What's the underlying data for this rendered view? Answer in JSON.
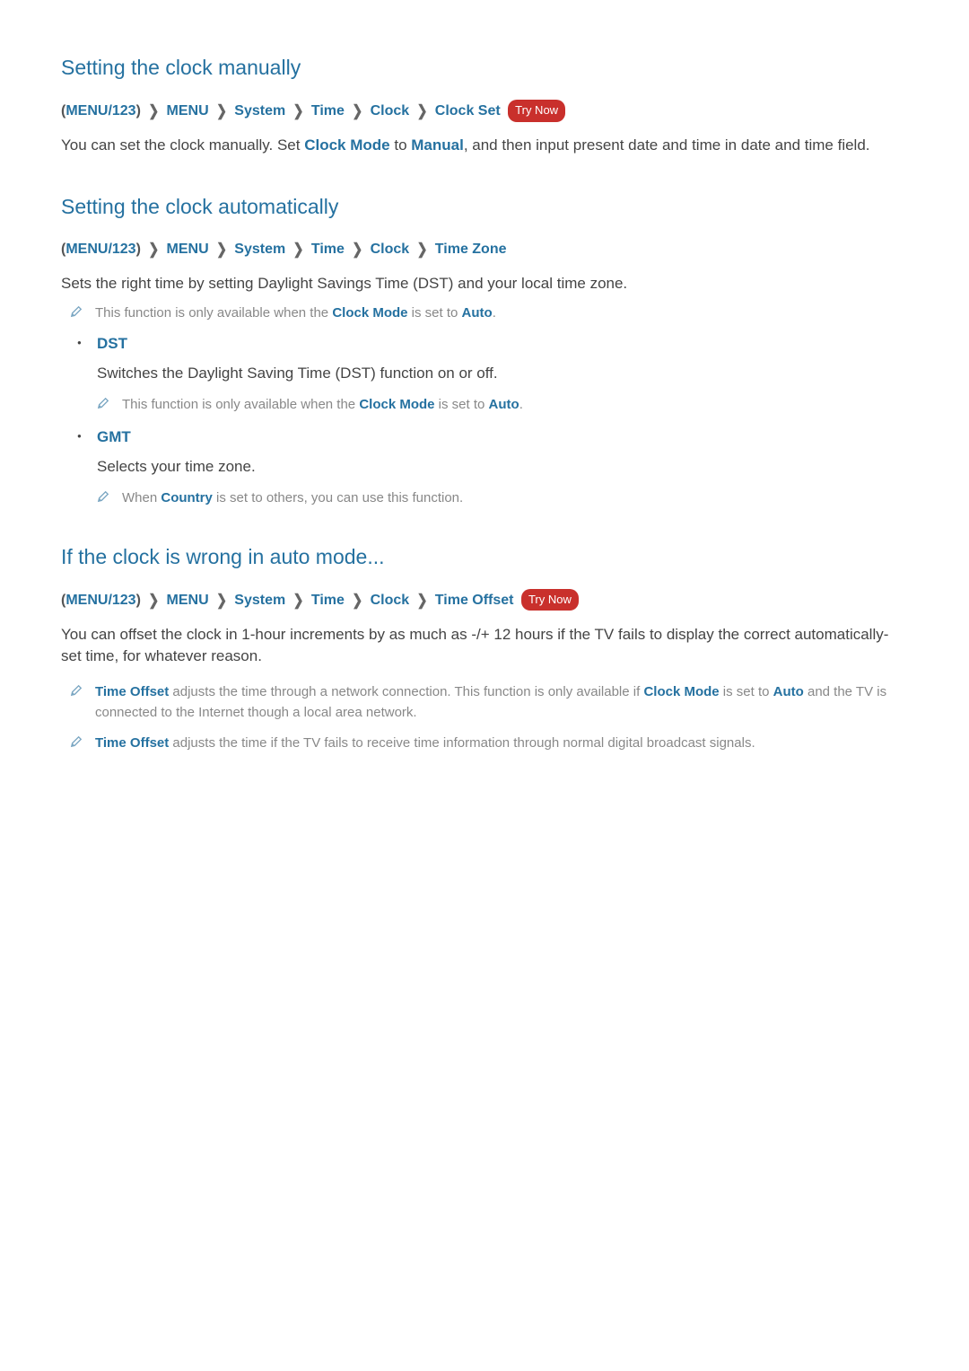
{
  "breadcrumb_button": "MENU/123",
  "breadcrumb_chevron": "❯",
  "try_now_label": "Try Now",
  "section1": {
    "title": "Setting the clock manually",
    "bc": [
      "MENU",
      "System",
      "Time",
      "Clock",
      "Clock Set"
    ],
    "try_now": true,
    "body_pre": "You can set the clock manually. Set ",
    "body_hl1": "Clock Mode",
    "body_mid": " to ",
    "body_hl2": "Manual",
    "body_post": ", and then input present date and time in date and time field."
  },
  "section2": {
    "title": "Setting the clock automatically",
    "bc": [
      "MENU",
      "System",
      "Time",
      "Clock",
      "Time Zone"
    ],
    "try_now": false,
    "body": "Sets the right time by setting Daylight Savings Time (DST) and your local time zone.",
    "note1_pre": "This function is only available when the ",
    "note1_hl1": "Clock Mode",
    "note1_mid": " is set to ",
    "note1_hl2": "Auto",
    "note1_post": ".",
    "options": {
      "dst": {
        "name": "DST",
        "desc": "Switches the Daylight Saving Time (DST) function on or off.",
        "note_pre": "This function is only available when the ",
        "note_hl1": "Clock Mode",
        "note_mid": " is set to ",
        "note_hl2": "Auto",
        "note_post": "."
      },
      "gmt": {
        "name": "GMT",
        "desc": "Selects your time zone.",
        "note_pre": "When ",
        "note_hl1": "Country",
        "note_post": " is set to others, you can use this function."
      }
    }
  },
  "section3": {
    "title": "If the clock is wrong in auto mode...",
    "bc": [
      "MENU",
      "System",
      "Time",
      "Clock",
      "Time Offset"
    ],
    "try_now": true,
    "body": "You can offset the clock in 1-hour increments by as much as -/+ 12 hours if the TV fails to display the correct automatically-set time, for whatever reason.",
    "note1_hl1": "Time Offset",
    "note1_mid1": " adjusts the time through a network connection. This function is only available if ",
    "note1_hl2": "Clock Mode",
    "note1_mid2": " is set to ",
    "note1_hl3": "Auto",
    "note1_post": " and the TV is connected to the Internet though a local area network.",
    "note2_hl1": "Time Offset",
    "note2_post": " adjusts the time if the TV fails to receive time information through normal digital broadcast signals."
  }
}
